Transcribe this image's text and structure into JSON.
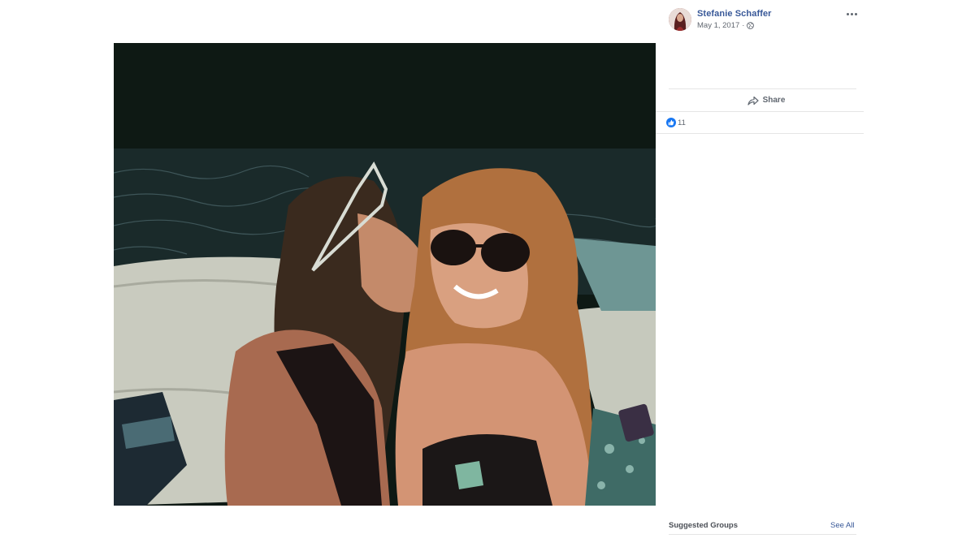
{
  "post": {
    "author": "Stefanie Schaffer",
    "date": "May 1, 2017",
    "separator": "·",
    "privacy_icon": "globe-icon",
    "more_icon": "ellipsis-icon"
  },
  "actions": {
    "share_label": "Share",
    "share_icon": "share-arrow-icon"
  },
  "reactions": {
    "icon": "like-icon",
    "count": "11"
  },
  "suggested_groups": {
    "title": "Suggested Groups",
    "see_all": "See All"
  },
  "colors": {
    "link": "#385898",
    "like_blue": "#1877f2",
    "muted_text": "#606770"
  }
}
